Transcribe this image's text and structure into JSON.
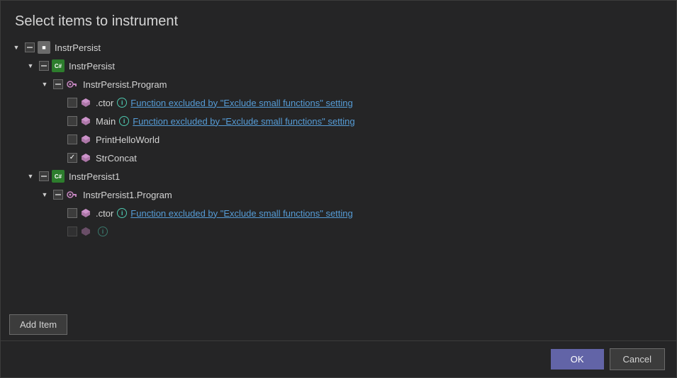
{
  "dialog": {
    "title": "Select items to instrument",
    "add_item_label": "Add Item",
    "ok_label": "OK",
    "cancel_label": "Cancel"
  },
  "tree": {
    "rows": [
      {
        "id": "row-instrpersist-assembly",
        "indent": 0,
        "arrow": "expanded",
        "checkbox": "indeterminate",
        "icon": "assembly",
        "label": "InstrPersist",
        "info": false,
        "link": ""
      },
      {
        "id": "row-instrpersist-class",
        "indent": 1,
        "arrow": "expanded",
        "checkbox": "indeterminate",
        "icon": "class-cs",
        "label": "InstrPersist",
        "info": false,
        "link": ""
      },
      {
        "id": "row-instrpersist-program",
        "indent": 2,
        "arrow": "expanded",
        "checkbox": "indeterminate",
        "icon": "namespace",
        "label": "InstrPersist.Program",
        "info": false,
        "link": ""
      },
      {
        "id": "row-ctor1",
        "indent": 3,
        "arrow": "none",
        "checkbox": "unchecked",
        "icon": "method",
        "label": ".ctor",
        "info": true,
        "link": "Function excluded by \"Exclude small functions\" setting"
      },
      {
        "id": "row-main",
        "indent": 3,
        "arrow": "none",
        "checkbox": "unchecked",
        "icon": "method",
        "label": "Main",
        "info": true,
        "link": "Function excluded by \"Exclude small functions\" setting"
      },
      {
        "id": "row-printhelloworld",
        "indent": 3,
        "arrow": "none",
        "checkbox": "unchecked",
        "icon": "method",
        "label": "PrintHelloWorld",
        "info": false,
        "link": ""
      },
      {
        "id": "row-strconcat",
        "indent": 3,
        "arrow": "none",
        "checkbox": "checked",
        "icon": "method",
        "label": "StrConcat",
        "info": false,
        "link": ""
      },
      {
        "id": "row-instrpersist1-class",
        "indent": 1,
        "arrow": "expanded",
        "checkbox": "indeterminate",
        "icon": "class-cs",
        "label": "InstrPersist1",
        "info": false,
        "link": ""
      },
      {
        "id": "row-instrpersist1-program",
        "indent": 2,
        "arrow": "expanded",
        "checkbox": "indeterminate",
        "icon": "namespace",
        "label": "InstrPersist1.Program",
        "info": false,
        "link": ""
      },
      {
        "id": "row-ctor2",
        "indent": 3,
        "arrow": "none",
        "checkbox": "unchecked",
        "icon": "method",
        "label": ".ctor",
        "info": true,
        "link": "Function excluded by \"Exclude small functions\" setting"
      }
    ]
  }
}
